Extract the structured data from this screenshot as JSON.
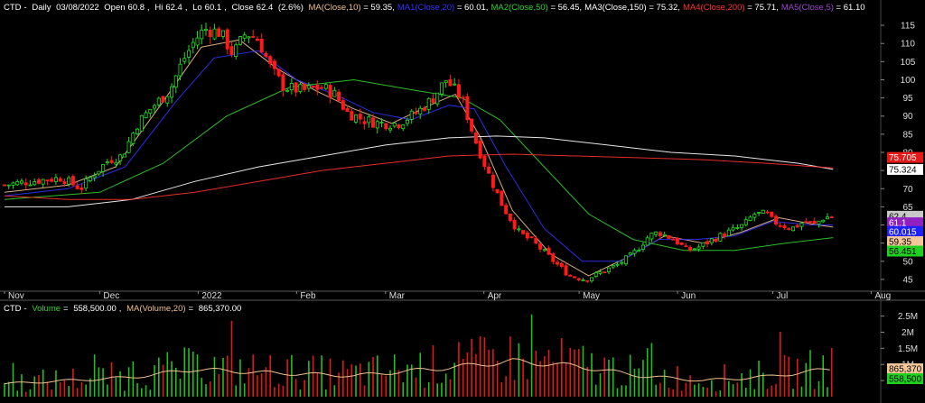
{
  "header": {
    "ticker": "CTD",
    "period": "Daily",
    "date": "03/08/2022",
    "open_label": "Open",
    "open": "60.8",
    "high_label": "Hi",
    "high": "62.4",
    "low_label": "Lo",
    "low": "60.1",
    "close_label": "Close",
    "close": "62.4",
    "change": "(2.6%)",
    "ma_items": [
      {
        "label": "MA(Close,10)",
        "value": "59.35",
        "color": "#f0c090"
      },
      {
        "label": "MA1(Close,20)",
        "value": "60.01",
        "color": "#3030ff"
      },
      {
        "label": "MA2(Close,50)",
        "value": "56.45",
        "color": "#30d030"
      },
      {
        "label": "MA3(Close,150)",
        "value": "75.32",
        "color": "#ffffff"
      },
      {
        "label": "MA4(Close,200)",
        "value": "75.71",
        "color": "#ff3030"
      },
      {
        "label": "MA5(Close,5)",
        "value": "61.10",
        "color": "#a040d0"
      }
    ]
  },
  "volume_header": {
    "ticker": "CTD",
    "label": "Volume",
    "value": "558,500.00",
    "ma_label": "MA(Volume,20)",
    "ma_value": "865,370.00"
  },
  "chart_data": [
    {
      "type": "candlestick",
      "title": "CTD - Daily 03/08/2022",
      "x_labels": [
        {
          "label": "Nov",
          "day": 0
        },
        {
          "label": "Dec",
          "day": 30
        },
        {
          "label": "2022",
          "day": 61
        },
        {
          "label": "Feb",
          "day": 92
        },
        {
          "label": "Mar",
          "day": 120
        },
        {
          "label": "Apr",
          "day": 151
        },
        {
          "label": "May",
          "day": 181
        },
        {
          "label": "Jun",
          "day": 212
        },
        {
          "label": "Jul",
          "day": 242
        },
        {
          "label": "Aug",
          "day": 273
        }
      ],
      "x_range": [
        0,
        276
      ],
      "y_range": [
        42,
        118
      ],
      "y_ticks": [
        45,
        50,
        55,
        60,
        65,
        70,
        75,
        80,
        85,
        90,
        95,
        100,
        105,
        110,
        115
      ],
      "price_anchors": [
        [
          0,
          71
        ],
        [
          8,
          72
        ],
        [
          18,
          73
        ],
        [
          24,
          70
        ],
        [
          28,
          74
        ],
        [
          33,
          78
        ],
        [
          37,
          79
        ],
        [
          42,
          88
        ],
        [
          46,
          92
        ],
        [
          52,
          97
        ],
        [
          56,
          105
        ],
        [
          60,
          111
        ],
        [
          63,
          114
        ],
        [
          68,
          113
        ],
        [
          72,
          107
        ],
        [
          76,
          113
        ],
        [
          80,
          111
        ],
        [
          84,
          103
        ],
        [
          88,
          98
        ],
        [
          94,
          97
        ],
        [
          100,
          98
        ],
        [
          104,
          96
        ],
        [
          108,
          91
        ],
        [
          113,
          89
        ],
        [
          118,
          88
        ],
        [
          124,
          88
        ],
        [
          130,
          91
        ],
        [
          135,
          95
        ],
        [
          139,
          100
        ],
        [
          141,
          98
        ],
        [
          144,
          95
        ],
        [
          148,
          84
        ],
        [
          152,
          75
        ],
        [
          157,
          65
        ],
        [
          162,
          58
        ],
        [
          167,
          55
        ],
        [
          173,
          50
        ],
        [
          178,
          46
        ],
        [
          183,
          45
        ],
        [
          188,
          47
        ],
        [
          193,
          49
        ],
        [
          198,
          52
        ],
        [
          203,
          57
        ],
        [
          206,
          58
        ],
        [
          211,
          56
        ],
        [
          215,
          53
        ],
        [
          219,
          54
        ],
        [
          223,
          56
        ],
        [
          228,
          58
        ],
        [
          233,
          60
        ],
        [
          236,
          63
        ],
        [
          240,
          63
        ],
        [
          242,
          61
        ],
        [
          245,
          60
        ],
        [
          248,
          59
        ],
        [
          252,
          61
        ],
        [
          255,
          60
        ],
        [
          258,
          62
        ],
        [
          261,
          62.4
        ]
      ],
      "series": [
        {
          "name": "MA(Close,10)",
          "color": "#f0c090",
          "points": [
            [
              0,
              69
            ],
            [
              20,
              71
            ],
            [
              35,
              76
            ],
            [
              50,
              94
            ],
            [
              62,
              109
            ],
            [
              74,
              111
            ],
            [
              86,
              103
            ],
            [
              98,
              97
            ],
            [
              110,
              92
            ],
            [
              122,
              88
            ],
            [
              134,
              93
            ],
            [
              142,
              96
            ],
            [
              150,
              84
            ],
            [
              160,
              64
            ],
            [
              172,
              52
            ],
            [
              184,
              46
            ],
            [
              196,
              51
            ],
            [
              208,
              57
            ],
            [
              220,
              55
            ],
            [
              232,
              58
            ],
            [
              244,
              62
            ],
            [
              256,
              60
            ],
            [
              261,
              59.4
            ]
          ]
        },
        {
          "name": "MA1(Close,20)",
          "color": "#3030ff",
          "points": [
            [
              0,
              68
            ],
            [
              20,
              70
            ],
            [
              38,
              76
            ],
            [
              54,
              94
            ],
            [
              66,
              106
            ],
            [
              80,
              108
            ],
            [
              92,
              100
            ],
            [
              104,
              96
            ],
            [
              116,
              91
            ],
            [
              128,
              89
            ],
            [
              140,
              93
            ],
            [
              148,
              92
            ],
            [
              158,
              76
            ],
            [
              170,
              59
            ],
            [
              182,
              50
            ],
            [
              194,
              50
            ],
            [
              206,
              56
            ],
            [
              218,
              56
            ],
            [
              230,
              57
            ],
            [
              242,
              61
            ],
            [
              254,
              60
            ],
            [
              261,
              60.0
            ]
          ]
        },
        {
          "name": "MA2(Close,50)",
          "color": "#30d030",
          "points": [
            [
              0,
              67
            ],
            [
              30,
              69
            ],
            [
              50,
              77
            ],
            [
              70,
              90
            ],
            [
              90,
              98
            ],
            [
              110,
              100
            ],
            [
              130,
              97
            ],
            [
              144,
              95
            ],
            [
              156,
              89
            ],
            [
              170,
              76
            ],
            [
              184,
              63
            ],
            [
              198,
              56
            ],
            [
              214,
              53
            ],
            [
              230,
              53
            ],
            [
              246,
              55
            ],
            [
              261,
              56.5
            ]
          ]
        },
        {
          "name": "MA3(Close,150)",
          "color": "#ffffff",
          "points": [
            [
              0,
              65
            ],
            [
              20,
              65
            ],
            [
              40,
              67
            ],
            [
              60,
              72
            ],
            [
              80,
              76
            ],
            [
              100,
              79
            ],
            [
              120,
              82
            ],
            [
              140,
              84
            ],
            [
              155,
              84.5
            ],
            [
              170,
              84
            ],
            [
              190,
              82
            ],
            [
              210,
              80
            ],
            [
              230,
              79
            ],
            [
              250,
              77
            ],
            [
              261,
              75.3
            ]
          ]
        },
        {
          "name": "MA4(Close,200)",
          "color": "#ff3030",
          "points": [
            [
              0,
              68
            ],
            [
              20,
              67
            ],
            [
              40,
              67
            ],
            [
              60,
              69
            ],
            [
              80,
              72
            ],
            [
              100,
              75
            ],
            [
              120,
              77
            ],
            [
              140,
              79
            ],
            [
              160,
              79.5
            ],
            [
              180,
              79
            ],
            [
              200,
              78.5
            ],
            [
              220,
              78
            ],
            [
              240,
              77
            ],
            [
              261,
              75.7
            ]
          ]
        }
      ],
      "price_tags": [
        {
          "text": "75.705",
          "value": 78.6,
          "bg": "#e81818",
          "fg": "#ffffff"
        },
        {
          "text": "75.324",
          "value": 75.3,
          "bg": "#ffffff",
          "fg": "#000000"
        },
        {
          "text": "62.4",
          "value": 62.4,
          "bg": "#c8c8c8",
          "fg": "#000000"
        },
        {
          "text": "61.1",
          "value": 60.6,
          "bg": "#9020c0",
          "fg": "#ffffff"
        },
        {
          "text": "60.015",
          "value": 58.2,
          "bg": "#2020ff",
          "fg": "#ffffff"
        },
        {
          "text": "59.35",
          "value": 55.4,
          "bg": "#f4c79a",
          "fg": "#000000"
        },
        {
          "text": "56.451",
          "value": 52.8,
          "bg": "#20d020",
          "fg": "#000000"
        }
      ]
    },
    {
      "type": "bar",
      "title": "Volume",
      "y_ticks": [
        {
          "label": "0.5M",
          "value": 500000
        },
        {
          "label": "1M",
          "value": 1000000
        },
        {
          "label": "1.5M",
          "value": 1500000
        },
        {
          "label": "2M",
          "value": 2000000
        },
        {
          "label": "2.5M",
          "value": 2500000
        }
      ],
      "y_range": [
        0,
        2600000
      ],
      "ma_anchors": [
        [
          0,
          400000
        ],
        [
          40,
          600000
        ],
        [
          60,
          850000
        ],
        [
          80,
          750000
        ],
        [
          110,
          650000
        ],
        [
          140,
          900000
        ],
        [
          160,
          1100000
        ],
        [
          180,
          950000
        ],
        [
          200,
          650000
        ],
        [
          220,
          500000
        ],
        [
          240,
          620000
        ],
        [
          261,
          865370
        ]
      ],
      "price_tags": [
        {
          "text": "865,370",
          "value": 865370,
          "bg": "#f4c79a",
          "fg": "#000000"
        },
        {
          "text": "558,500",
          "value": 558500,
          "bg": "#20d020",
          "fg": "#000000"
        }
      ]
    }
  ]
}
